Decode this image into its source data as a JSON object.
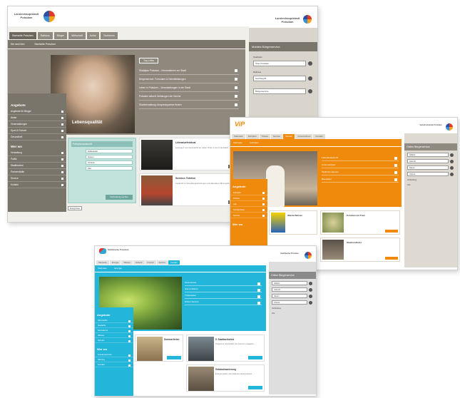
{
  "screens": [
    {
      "logo": "Landeshauptstadt Potsdam",
      "tabs": [
        "Startseite Potsdam",
        "Rathaus",
        "Bürger",
        "Wirtschaft",
        "Kultur",
        "Tourismus"
      ],
      "subnav": [
        "Sie sind hier:",
        "Startseite Potsdam"
      ],
      "hero_caption": "Lebensqualität",
      "hero_chip": "Top-Links",
      "hero_links": [
        "Stadtplan Potsdam – Informationen zur Stadt",
        "Bürgerservice: Formulare & Dienstleistungen",
        "Leben in Potsdam – Veranstaltungen in der Stadt",
        "Potsdam aktuell: Meldungen der Woche",
        "Stadtverwaltung: Ansprechpartner finden"
      ],
      "left_title_1": "Angebote",
      "left_items_1": [
        "Angebote für Bürger",
        "Ämter",
        "Veranstaltungen",
        "Sport & Freizeit",
        "Gesundheit"
      ],
      "left_title_2": "Wer wo",
      "left_items_2": [
        "Verwaltung",
        "Politik",
        "Stadtbezirke",
        "Partnerstädte",
        "Service",
        "Kontakt"
      ],
      "search_title": "Fahrplanauskunft",
      "search_fields": [
        "Haltestelle",
        "Datum",
        "Uhrzeit",
        "Ziel"
      ],
      "search_button": "Verbindung suchen",
      "news": [
        {
          "title": "Literaturfestival",
          "text": "Lesungen und Gespräche an vielen Orten in der Innenstadt."
        },
        {
          "title": "Service-Telefon",
          "text": "Auskunft zu Verwaltungsleistungen und aktuellen Öffnungszeiten."
        }
      ],
      "footer_link": "Ereignisse",
      "sidebar_logo": "Landeshauptstadt Potsdam",
      "sidebar_title": "Mobiles Bürgerservice",
      "sidebar_fields": [
        "Über Potsdam",
        "Suchbegriff",
        "Bürgerservice"
      ],
      "sidebar_labels": [
        "Stadtplan",
        "Rathaus"
      ]
    },
    {
      "logo": "ViP",
      "tabs": [
        "Startseite",
        "Fahrplan",
        "Tickets",
        "Service",
        "Verkehr",
        "Unternehmen",
        "Kontakt"
      ],
      "subnav": [
        "Startseite",
        "Fahrplan"
      ],
      "hero_links": [
        "Fahrplanauskunft",
        "Liniennetzplan",
        "Tarifinformationen",
        "Baustellen"
      ],
      "left_title_1": "Angebote",
      "left_items_1": [
        "Fahrplan",
        "Tickets",
        "Abo",
        "Schülerticket",
        "Service"
      ],
      "left_title_2": "Wer wo",
      "promos": [
        "Wanderfahrten",
        "Potsdam mit Tram",
        "Stadtrundfahrt"
      ],
      "sidebar_logo": "Verkehrsbetrieb Potsdam",
      "sidebar_title": "Online Bürgerservice",
      "sidebar_fields": [
        "Abfahrt",
        "Ankunft",
        "Datum",
        "Uhrzeit"
      ],
      "sidebar_labels": [
        "Verbindung",
        "Info"
      ]
    },
    {
      "logo": "Stadtwerke Potsdam",
      "tabs": [
        "Startseite",
        "Energie",
        "Wasser",
        "Verkehr",
        "Freizeit",
        "Service",
        "Kontakt"
      ],
      "subnav": [
        "Startseite",
        "Energie"
      ],
      "hero_links": [
        "Strompreise",
        "Gas & Wärme",
        "Trinkwasser",
        "Online Service"
      ],
      "left_title_1": "Angebote",
      "left_items_1": [
        "Stromtarife",
        "Gastarife",
        "Fernwärme",
        "Wasser",
        "Service"
      ],
      "left_title_2": "Wer wo",
      "left_items_2": [
        "Kundenzentrum",
        "Störung",
        "Kontakt"
      ],
      "news": [
        {
          "title": "Sommerferien",
          "text": "Familienangebote und Freizeitbad in den Ferien."
        },
        {
          "title": "5. Stadtwerkefest",
          "text": "Programm und Anfahrt zum Fest im Lustgarten."
        },
        {
          "title": "Gebäudesanierung",
          "text": "Energie sparen mit modernen Heizsystemen."
        }
      ],
      "sidebar_logo": "Stadtwerke Potsdam",
      "sidebar_title": "Online Bürgerservice",
      "sidebar_fields": [
        "Abfahrt",
        "Ankunft",
        "Datum",
        "Uhrzeit"
      ],
      "sidebar_labels": [
        "Verbindung",
        "Info"
      ]
    }
  ]
}
